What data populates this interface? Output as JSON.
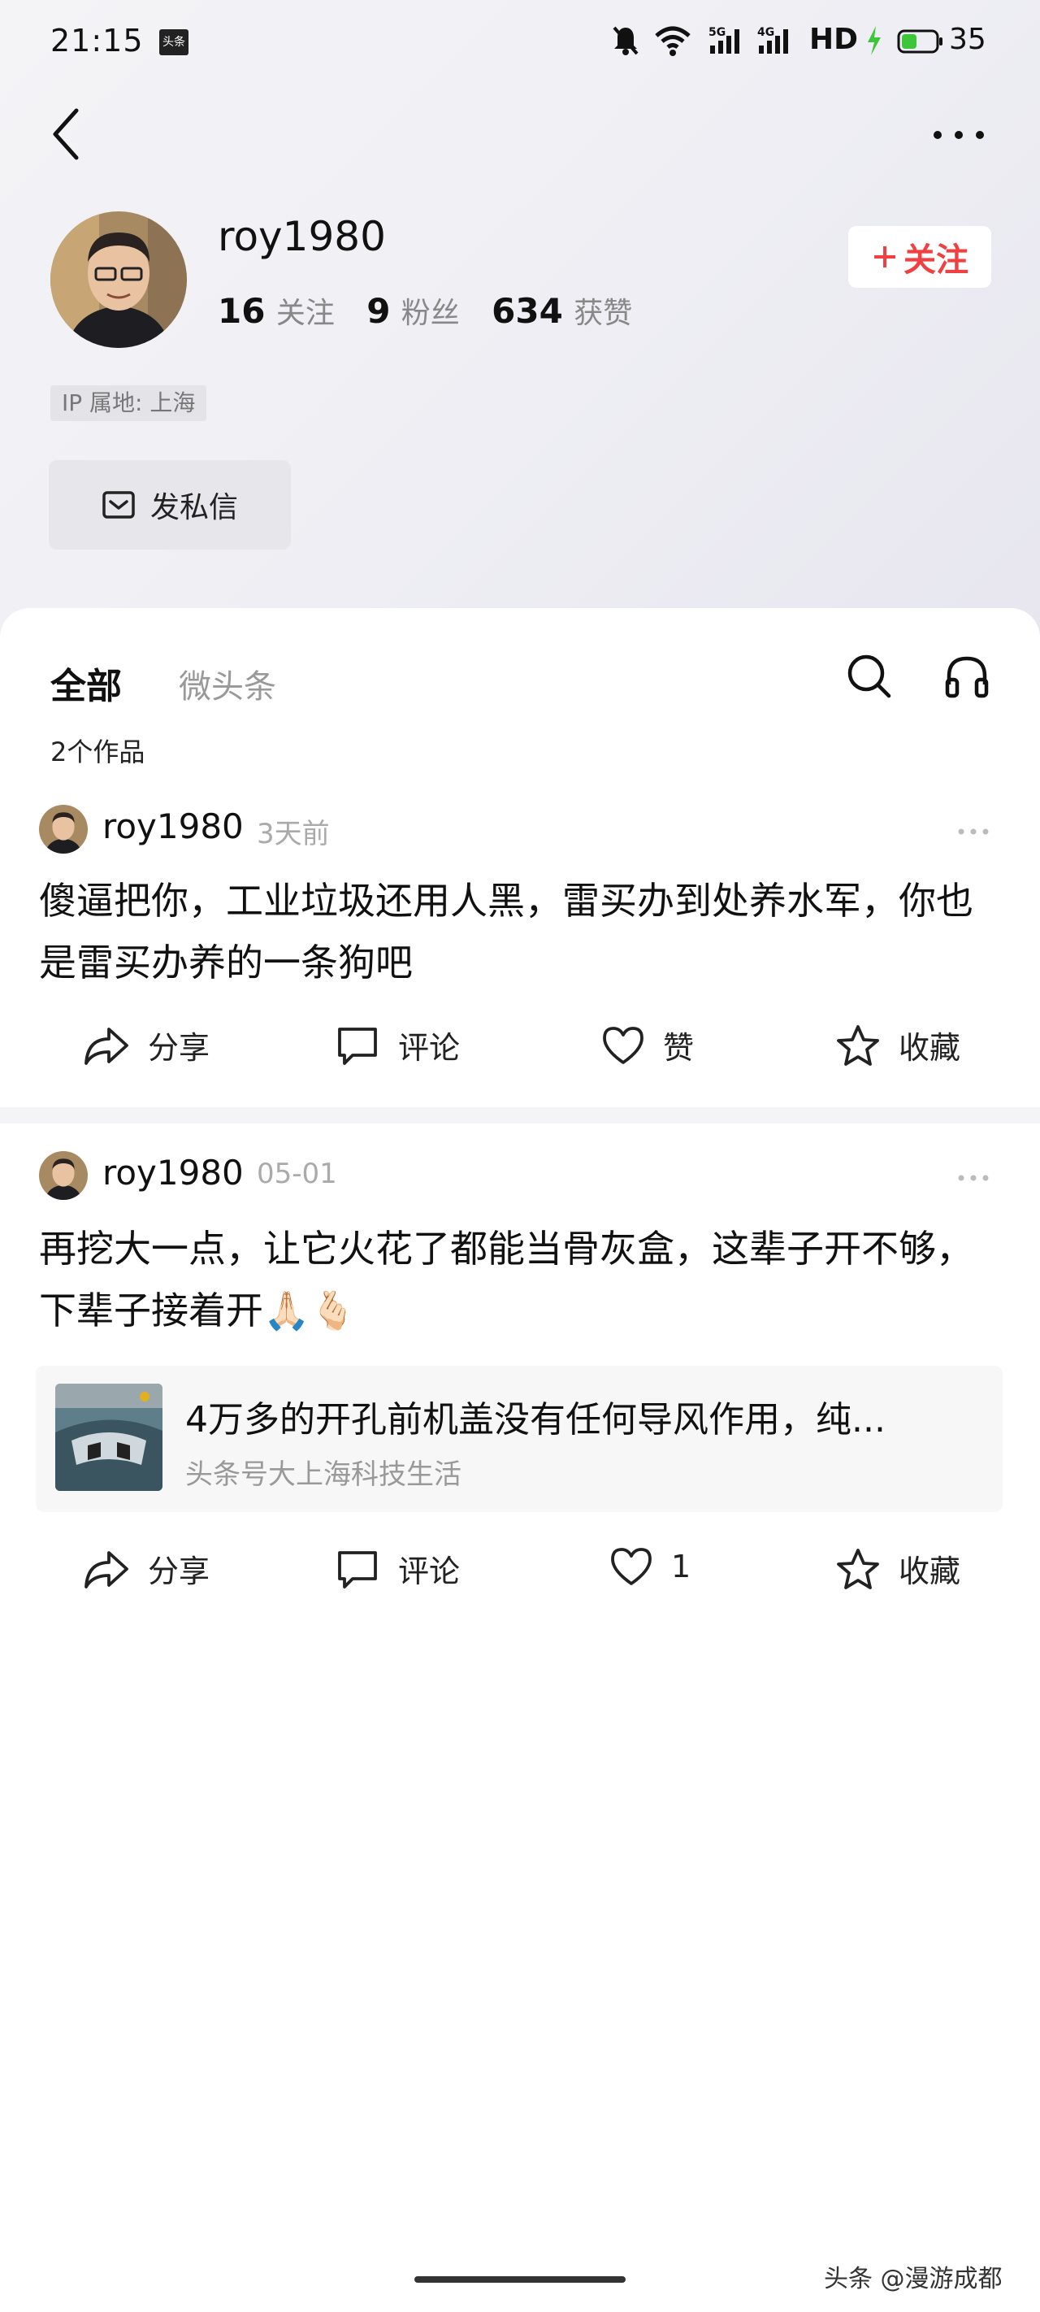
{
  "status_bar": {
    "time": "21:15",
    "app_badge": "头条",
    "network_5g": "5G",
    "network_4g": "4G",
    "hd": "HD",
    "battery": "35"
  },
  "profile": {
    "username": "roy1980",
    "following_count": "16",
    "following_label": "关注",
    "followers_count": "9",
    "followers_label": "粉丝",
    "likes_count": "634",
    "likes_label": "获赞",
    "follow_button": "关注",
    "ip_location": "IP 属地: 上海",
    "message_button": "发私信"
  },
  "tabs": {
    "all": "全部",
    "weitoutiao": "微头条"
  },
  "works_count": "2个作品",
  "posts": [
    {
      "username": "roy1980",
      "time": "3天前",
      "text": "傻逼把你，工业垃圾还用人黑，雷买办到处养水军，你也是雷买办养的一条狗吧",
      "actions": {
        "share": "分享",
        "comment": "评论",
        "like": "赞",
        "favorite": "收藏"
      }
    },
    {
      "username": "roy1980",
      "time": "05-01",
      "text": "再挖大一点，让它火花了都能当骨灰盒，这辈子开不够，下辈子接着开🙏🏻🫰🏻",
      "link": {
        "title": "4万多的开孔前机盖没有任何导风作用，纯...",
        "source": "头条号大上海科技生活"
      },
      "actions": {
        "share": "分享",
        "comment": "评论",
        "like": "1",
        "favorite": "收藏"
      }
    }
  ],
  "watermark": "头条 @漫游成都",
  "colors": {
    "accent_red": "#f04142",
    "charging_green": "#3ec53a"
  }
}
